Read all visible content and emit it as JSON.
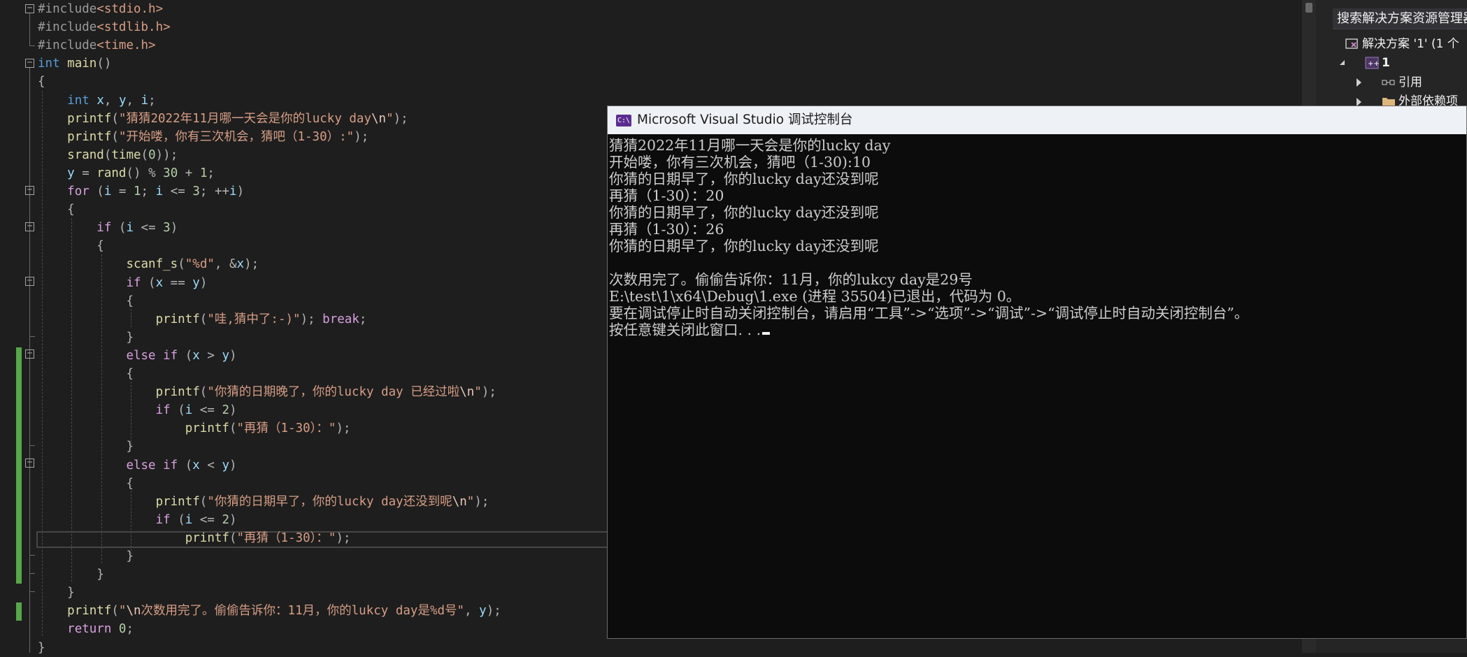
{
  "editor": {
    "lines": [
      [
        [
          "pp",
          "#include"
        ],
        [
          "inc",
          "<stdio.h>"
        ]
      ],
      [
        [
          "pp",
          "#include"
        ],
        [
          "inc",
          "<stdlib.h>"
        ]
      ],
      [
        [
          "pp",
          "#include"
        ],
        [
          "inc",
          "<time.h>"
        ]
      ],
      [
        [
          "kw",
          "int"
        ],
        [
          "t",
          " "
        ],
        [
          "fn",
          "main"
        ],
        [
          "pun",
          "()"
        ]
      ],
      [
        [
          "pun",
          "{"
        ]
      ],
      [
        [
          "t",
          "    "
        ],
        [
          "kw",
          "int"
        ],
        [
          "t",
          " "
        ],
        [
          "var",
          "x"
        ],
        [
          "pun",
          ", "
        ],
        [
          "var",
          "y"
        ],
        [
          "pun",
          ", "
        ],
        [
          "var",
          "i"
        ],
        [
          "pun",
          ";"
        ]
      ],
      [
        [
          "t",
          "    "
        ],
        [
          "fn",
          "printf"
        ],
        [
          "pun",
          "("
        ],
        [
          "str",
          "\"猜猜2022年11月哪一天会是你的lucky day"
        ],
        [
          "esc",
          "\\n"
        ],
        [
          "str",
          "\""
        ],
        [
          "pun",
          ");"
        ]
      ],
      [
        [
          "t",
          "    "
        ],
        [
          "fn",
          "printf"
        ],
        [
          "pun",
          "("
        ],
        [
          "str",
          "\"开始喽，你有三次机会，猜吧（1-30）:\""
        ],
        [
          "pun",
          ");"
        ]
      ],
      [
        [
          "t",
          "    "
        ],
        [
          "fn",
          "srand"
        ],
        [
          "pun",
          "("
        ],
        [
          "fn",
          "time"
        ],
        [
          "pun",
          "("
        ],
        [
          "num",
          "0"
        ],
        [
          "pun",
          "));"
        ]
      ],
      [
        [
          "t",
          "    "
        ],
        [
          "var",
          "y"
        ],
        [
          "pun",
          " = "
        ],
        [
          "fn",
          "rand"
        ],
        [
          "pun",
          "() % "
        ],
        [
          "num",
          "30"
        ],
        [
          "pun",
          " + "
        ],
        [
          "num",
          "1"
        ],
        [
          "pun",
          ";"
        ]
      ],
      [
        [
          "t",
          "    "
        ],
        [
          "kw2",
          "for"
        ],
        [
          "pun",
          " ("
        ],
        [
          "var",
          "i"
        ],
        [
          "pun",
          " = "
        ],
        [
          "num",
          "1"
        ],
        [
          "pun",
          "; "
        ],
        [
          "var",
          "i"
        ],
        [
          "pun",
          " <= "
        ],
        [
          "num",
          "3"
        ],
        [
          "pun",
          "; ++"
        ],
        [
          "var",
          "i"
        ],
        [
          "pun",
          ")"
        ]
      ],
      [
        [
          "t",
          "    "
        ],
        [
          "pun",
          "{"
        ]
      ],
      [
        [
          "t",
          "        "
        ],
        [
          "kw2",
          "if"
        ],
        [
          "pun",
          " ("
        ],
        [
          "var",
          "i"
        ],
        [
          "pun",
          " <= "
        ],
        [
          "num",
          "3"
        ],
        [
          "pun",
          ")"
        ]
      ],
      [
        [
          "t",
          "        "
        ],
        [
          "pun",
          "{"
        ]
      ],
      [
        [
          "t",
          "            "
        ],
        [
          "fn",
          "scanf_s"
        ],
        [
          "pun",
          "("
        ],
        [
          "str",
          "\"%d\""
        ],
        [
          "pun",
          ", &"
        ],
        [
          "var",
          "x"
        ],
        [
          "pun",
          ");"
        ]
      ],
      [
        [
          "t",
          "            "
        ],
        [
          "kw2",
          "if"
        ],
        [
          "pun",
          " ("
        ],
        [
          "var",
          "x"
        ],
        [
          "pun",
          " == "
        ],
        [
          "var",
          "y"
        ],
        [
          "pun",
          ")"
        ]
      ],
      [
        [
          "t",
          "            "
        ],
        [
          "pun",
          "{"
        ]
      ],
      [
        [
          "t",
          "                "
        ],
        [
          "fn",
          "printf"
        ],
        [
          "pun",
          "("
        ],
        [
          "str",
          "\"哇,猜中了:-)\""
        ],
        [
          "pun",
          "); "
        ],
        [
          "kw2",
          "break"
        ],
        [
          "pun",
          ";"
        ]
      ],
      [
        [
          "t",
          "            "
        ],
        [
          "pun",
          "}"
        ]
      ],
      [
        [
          "t",
          "            "
        ],
        [
          "kw2",
          "else if"
        ],
        [
          "pun",
          " ("
        ],
        [
          "var",
          "x"
        ],
        [
          "pun",
          " > "
        ],
        [
          "var",
          "y"
        ],
        [
          "pun",
          ")"
        ]
      ],
      [
        [
          "t",
          "            "
        ],
        [
          "pun",
          "{"
        ]
      ],
      [
        [
          "t",
          "                "
        ],
        [
          "fn",
          "printf"
        ],
        [
          "pun",
          "("
        ],
        [
          "str",
          "\"你猜的日期晚了，你的lucky day 已经过啦"
        ],
        [
          "esc",
          "\\n"
        ],
        [
          "str",
          "\""
        ],
        [
          "pun",
          ");"
        ]
      ],
      [
        [
          "t",
          "                "
        ],
        [
          "kw2",
          "if"
        ],
        [
          "pun",
          " ("
        ],
        [
          "var",
          "i"
        ],
        [
          "pun",
          " <= "
        ],
        [
          "num",
          "2"
        ],
        [
          "pun",
          ")"
        ]
      ],
      [
        [
          "t",
          "                    "
        ],
        [
          "fn",
          "printf"
        ],
        [
          "pun",
          "("
        ],
        [
          "str",
          "\"再猜（1-30）：\""
        ],
        [
          "pun",
          ");"
        ]
      ],
      [
        [
          "t",
          "            "
        ],
        [
          "pun",
          "}"
        ]
      ],
      [
        [
          "t",
          "            "
        ],
        [
          "kw2",
          "else if"
        ],
        [
          "pun",
          " ("
        ],
        [
          "var",
          "x"
        ],
        [
          "pun",
          " < "
        ],
        [
          "var",
          "y"
        ],
        [
          "pun",
          ")"
        ]
      ],
      [
        [
          "t",
          "            "
        ],
        [
          "pun",
          "{"
        ]
      ],
      [
        [
          "t",
          "                "
        ],
        [
          "fn",
          "printf"
        ],
        [
          "pun",
          "("
        ],
        [
          "str",
          "\"你猜的日期早了，你的lucky day还没到呢"
        ],
        [
          "esc",
          "\\n"
        ],
        [
          "str",
          "\""
        ],
        [
          "pun",
          ");"
        ]
      ],
      [
        [
          "t",
          "                "
        ],
        [
          "kw2",
          "if"
        ],
        [
          "pun",
          " ("
        ],
        [
          "var",
          "i"
        ],
        [
          "pun",
          " <= "
        ],
        [
          "num",
          "2"
        ],
        [
          "pun",
          ")"
        ]
      ],
      [
        [
          "t",
          "                    "
        ],
        [
          "fn",
          "printf"
        ],
        [
          "pun",
          "("
        ],
        [
          "str",
          "\"再猜（1-30）：\""
        ],
        [
          "pun",
          ");"
        ]
      ],
      [
        [
          "t",
          "            "
        ],
        [
          "pun",
          "}"
        ]
      ],
      [
        [
          "t",
          "        "
        ],
        [
          "pun",
          "}"
        ]
      ],
      [
        [
          "t",
          "    "
        ],
        [
          "pun",
          "}"
        ]
      ],
      [
        [
          "t",
          "    "
        ],
        [
          "fn",
          "printf"
        ],
        [
          "pun",
          "("
        ],
        [
          "str",
          "\""
        ],
        [
          "esc",
          "\\n"
        ],
        [
          "str",
          "次数用完了。偷偷告诉你：11月，你的lukcy day是%d号\""
        ],
        [
          "pun",
          ", "
        ],
        [
          "var",
          "y"
        ],
        [
          "pun",
          ");"
        ]
      ],
      [
        [
          "t",
          "    "
        ],
        [
          "kw2",
          "return"
        ],
        [
          "t",
          " "
        ],
        [
          "num",
          "0"
        ],
        [
          "pun",
          ";"
        ]
      ],
      [
        [
          "pun",
          "}"
        ]
      ]
    ]
  },
  "console": {
    "icon_text": "C:\\",
    "title": "Microsoft Visual Studio 调试控制台",
    "lines": [
      "猜猜2022年11月哪一天会是你的lucky day",
      "开始喽，你有三次机会，猜吧（1-30):10",
      "你猜的日期早了，你的lucky day还没到呢",
      "再猜（1-30）：20",
      "你猜的日期早了，你的lucky day还没到呢",
      "再猜（1-30）：26",
      "你猜的日期早了，你的lucky day还没到呢",
      "",
      "次数用完了。偷偷告诉你：11月，你的lukcy day是29号",
      "E:\\test\\1\\x64\\Debug\\1.exe (进程 35504)已退出，代码为 0。",
      "要在调试停止时自动关闭控制台，请启用“工具”->“选项”->“调试”->“调试停止时自动关闭控制台”。",
      "按任意键关闭此窗口. . ."
    ]
  },
  "solution_explorer": {
    "search_placeholder": "搜索解决方案资源管理器",
    "solution_label": "解决方案 '1' (1 个",
    "project_label": "1",
    "references_label": "引用",
    "external_deps_label": "外部依赖项"
  },
  "colors": {
    "editor_bg": "#1e1e1e",
    "console_bg": "#0c0c0c",
    "change_marker": "#57a64a",
    "vs_purple": "#5c2d91"
  }
}
